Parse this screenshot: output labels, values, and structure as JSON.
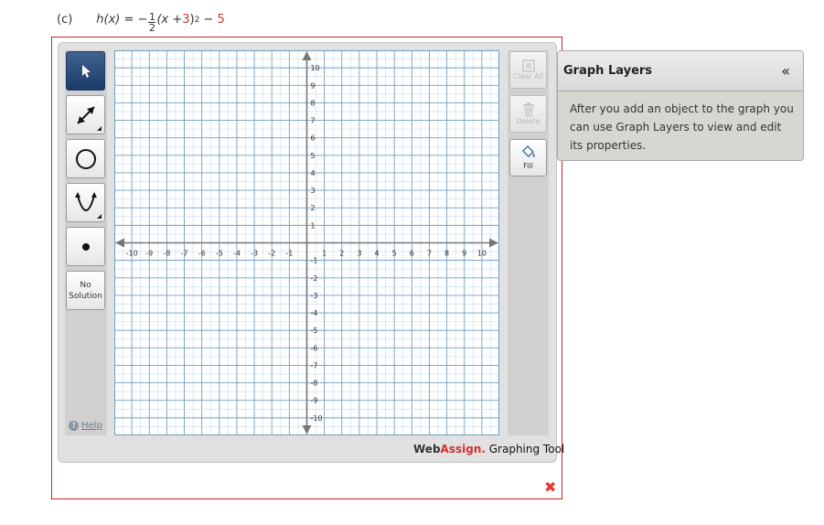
{
  "problem": {
    "part": "(c)",
    "func_name": "h(x)",
    "equals": "=",
    "sign": "−",
    "frac_num": "1",
    "frac_den": "2",
    "expr_open": "(x + ",
    "shift": "3",
    "expr_close": ")",
    "power": "2",
    "minus": " − ",
    "constant": "5"
  },
  "tools": {
    "pointer": "pointer-tool",
    "line": "line-tool",
    "circle": "circle-tool",
    "parabola": "parabola-tool",
    "point": "point-tool",
    "no_solution_line1": "No",
    "no_solution_line2": "Solution"
  },
  "actions": {
    "clear_all": "Clear All",
    "delete": "Delete",
    "fill": "Fill"
  },
  "help_label": "Help",
  "branding": {
    "web": "Web",
    "assign": "Assign.",
    "product": " Graphing Tool"
  },
  "close_glyph": "✖",
  "layers": {
    "title": "Graph Layers",
    "collapse": "«",
    "description": "After you add an object to the graph you can use Graph Layers to view and edit its properties."
  },
  "graph": {
    "x_min": -11,
    "x_max": 11,
    "y_min": -11,
    "y_max": 11,
    "tick_labels_x": [
      -10,
      -9,
      -8,
      -7,
      -6,
      -5,
      -4,
      -3,
      -2,
      -1,
      1,
      2,
      3,
      4,
      5,
      6,
      7,
      8,
      9,
      10
    ],
    "tick_labels_y": [
      10,
      9,
      8,
      7,
      6,
      5,
      4,
      3,
      2,
      1,
      -1,
      -2,
      -3,
      -4,
      -5,
      -6,
      -7,
      -8,
      -9,
      -10
    ],
    "minor_per_unit": 2,
    "colors": {
      "grid_minor": "#c5dbe8",
      "grid_major": "#6f9fc0",
      "axis": "#777777",
      "border": "#6f9fc0"
    }
  }
}
